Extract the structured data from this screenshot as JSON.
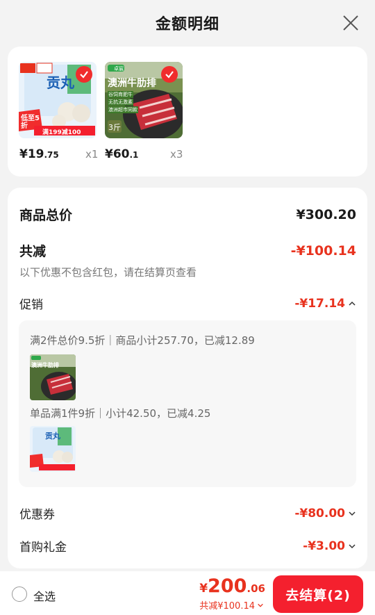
{
  "header": {
    "title": "金额明细"
  },
  "products": [
    {
      "name": "gongwan-meatballs",
      "img_badge": "低至5折",
      "img_title": "贡丸",
      "img_promo": "满199减100",
      "price_main": "¥19",
      "price_dec": ".75",
      "qty": "x1"
    },
    {
      "name": "beef-short-ribs",
      "img_brand": "卓宸",
      "img_title": "澳洲牛肋排",
      "img_tags": [
        "谷饲育肥牛",
        "无抗无激素",
        "澳洲超市同款"
      ],
      "img_weight": "3斤",
      "price_main": "¥60",
      "price_dec": ".1",
      "qty": "x3"
    }
  ],
  "summary": {
    "total_label": "商品总价",
    "total_value": "¥300.20",
    "discount_label": "共减",
    "discount_value": "-¥100.14",
    "note": "以下优惠不包含红包，请在结算页查看",
    "promo_label": "促销",
    "promo_value": "-¥17.14",
    "promo_details": [
      {
        "text": "满2件总价9.5折｜商品小计257.70，已减12.89"
      },
      {
        "text": "单品满1件9折｜小计42.50，已减4.25"
      }
    ],
    "coupon_label": "优惠券",
    "coupon_value": "-¥80.00",
    "gift_label": "首购礼金",
    "gift_value": "-¥3.00"
  },
  "footer": {
    "select_all": "全选",
    "total_cur": "¥",
    "total_amt": "200",
    "total_dec": ".06",
    "total_discount": "共减¥100.14",
    "checkout": "去结算(2)"
  },
  "colors": {
    "accent": "#e8321e",
    "button": "#f4202e"
  }
}
